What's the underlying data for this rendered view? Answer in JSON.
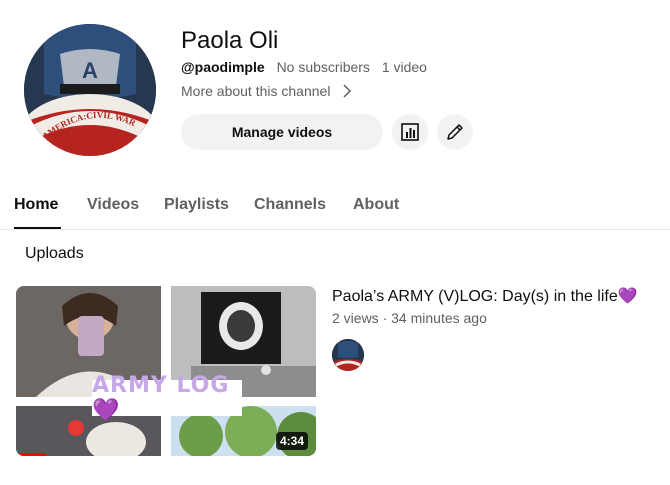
{
  "channel": {
    "name": "Paola Oli",
    "handle": "@paodimple",
    "subscribers": "No subscribers",
    "videos_count": "1 video",
    "more_link": "More about this channel",
    "avatar_caption": "AMERICA:CIVIL WAR"
  },
  "actions": {
    "manage_label": "Manage videos",
    "analytics_icon": "analytics-icon",
    "edit_icon": "pencil-icon"
  },
  "tabs": [
    {
      "label": "Home",
      "active": true
    },
    {
      "label": "Videos",
      "active": false
    },
    {
      "label": "Playlists",
      "active": false
    },
    {
      "label": "Channels",
      "active": false
    },
    {
      "label": "About",
      "active": false
    }
  ],
  "uploads": {
    "section_title": "Uploads",
    "video": {
      "title": "Paola’s ARMY (V)LOG: Day(s) in the life💜",
      "views": "2 views",
      "age": "34 minutes ago",
      "duration": "4:34",
      "thumb_text": "ARMY LOG💜",
      "watch_progress": 0.1
    }
  },
  "colors": {
    "accent_red": "#ff0000",
    "button_bg": "#f2f2f2",
    "secondary_text": "#606060",
    "thumb_text_purple": "#c6a7e8"
  }
}
